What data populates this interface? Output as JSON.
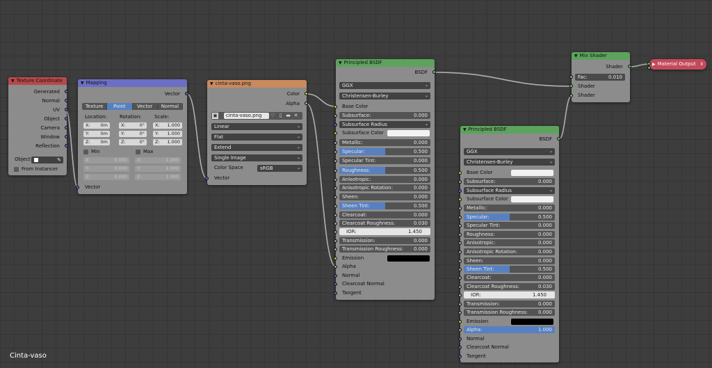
{
  "texture_coordinate": {
    "title": "Texture Coordinate",
    "outputs": [
      "Generated",
      "Normal",
      "UV",
      "Object",
      "Camera",
      "Window",
      "Reflection"
    ],
    "object_label": "Object",
    "from_instancer": "From Instancer"
  },
  "mapping": {
    "title": "Mapping",
    "output": "Vector",
    "tabs": [
      "Texture",
      "Point",
      "Vector",
      "Normal"
    ],
    "active_tab": "Point",
    "location_label": "Location:",
    "rotation_label": "Rotation:",
    "scale_label": "Scale:",
    "location": [
      {
        "axis": "X:",
        "value": "0m"
      },
      {
        "axis": "Y:",
        "value": "0m"
      },
      {
        "axis": "Z:",
        "value": "0m"
      }
    ],
    "rotation": [
      {
        "axis": "X:",
        "value": "0°"
      },
      {
        "axis": "Y:",
        "value": "0°"
      },
      {
        "axis": "Z:",
        "value": "0°"
      }
    ],
    "scale": [
      {
        "axis": "X:",
        "value": "1.000"
      },
      {
        "axis": "Y:",
        "value": "1.000"
      },
      {
        "axis": "Z:",
        "value": "1.000"
      }
    ],
    "min_label": "Min",
    "max_label": "Max",
    "min": [
      {
        "axis": "X:",
        "value": "0.000"
      },
      {
        "axis": "Y:",
        "value": "0.000"
      },
      {
        "axis": "Z:",
        "value": "0.000"
      }
    ],
    "max": [
      {
        "axis": "X:",
        "value": "1.000"
      },
      {
        "axis": "Y:",
        "value": "1.000"
      },
      {
        "axis": "Z:",
        "value": "1.000"
      }
    ],
    "input": "Vector"
  },
  "image_texture": {
    "title": "cinta-vaso.png",
    "outputs": [
      "Color",
      "Alpha"
    ],
    "image_name": "cinta-vaso.png",
    "interpolation": "Linear",
    "projection": "Flat",
    "extension": "Extend",
    "source": "Single Image",
    "color_space_label": "Color Space",
    "color_space": "sRGB",
    "input": "Vector"
  },
  "bsdf1": {
    "title": "Principled BSDF",
    "output": "BSDF",
    "distribution": "GGX",
    "subsurface_method": "Christensen-Burley",
    "base_color": "Base Color",
    "subsurface": {
      "label": "Subsurface:",
      "value": "0.000"
    },
    "subsurface_radius": "Subsurface Radius",
    "subsurface_color": "Subsurface Color",
    "params": [
      {
        "label": "Metallic:",
        "value": "0.000",
        "fill": 0
      },
      {
        "label": "Specular:",
        "value": "0.500",
        "fill": 0.5
      },
      {
        "label": "Specular Tint:",
        "value": "0.000",
        "fill": 0
      },
      {
        "label": "Roughness:",
        "value": "0.500",
        "fill": 0.5
      },
      {
        "label": "Anisotropic:",
        "value": "0.000",
        "fill": 0
      },
      {
        "label": "Anisotropic Rotation:",
        "value": "0.000",
        "fill": 0
      },
      {
        "label": "Sheen:",
        "value": "0.000",
        "fill": 0
      },
      {
        "label": "Sheen Tint:",
        "value": "0.500",
        "fill": 0.5
      },
      {
        "label": "Clearcoat:",
        "value": "0.000",
        "fill": 0
      },
      {
        "label": "Clearcoat Roughness:",
        "value": "0.030",
        "fill": 0
      }
    ],
    "ior": {
      "label": "IOR:",
      "value": "1.450"
    },
    "params2": [
      {
        "label": "Transmission:",
        "value": "0.000",
        "fill": 0
      },
      {
        "label": "Transmission Roughness:",
        "value": "0.000",
        "fill": 0
      }
    ],
    "emission": "Emission",
    "tail": [
      "Alpha",
      "Normal",
      "Clearcoat Normal",
      "Tangent"
    ]
  },
  "bsdf2": {
    "title": "Principled BSDF",
    "output": "BSDF",
    "distribution": "GGX",
    "subsurface_method": "Christensen-Burley",
    "base_color": "Base Color",
    "subsurface": {
      "label": "Subsurface:",
      "value": "0.000"
    },
    "subsurface_radius": "Subsurface Radius",
    "subsurface_color": "Subsurface Color",
    "params": [
      {
        "label": "Metallic:",
        "value": "0.000",
        "fill": 0
      },
      {
        "label": "Specular:",
        "value": "0.500",
        "fill": 0.5
      },
      {
        "label": "Specular Tint:",
        "value": "0.000",
        "fill": 0
      },
      {
        "label": "Roughness:",
        "value": "0.000",
        "fill": 0
      },
      {
        "label": "Anisotropic:",
        "value": "0.000",
        "fill": 0
      },
      {
        "label": "Anisotropic Rotation:",
        "value": "0.000",
        "fill": 0
      },
      {
        "label": "Sheen:",
        "value": "0.000",
        "fill": 0
      },
      {
        "label": "Sheen Tint:",
        "value": "0.500",
        "fill": 0.5
      },
      {
        "label": "Clearcoat:",
        "value": "0.000",
        "fill": 0
      },
      {
        "label": "Clearcoat Roughness:",
        "value": "0.030",
        "fill": 0
      }
    ],
    "ior": {
      "label": "IOR:",
      "value": "1.450"
    },
    "params2": [
      {
        "label": "Transmission:",
        "value": "0.000",
        "fill": 0
      },
      {
        "label": "Transmission Roughness:",
        "value": "0.000",
        "fill": 0
      }
    ],
    "emission": "Emission",
    "alpha": {
      "label": "Alpha:",
      "value": "1.000",
      "fill": 1
    },
    "tail": [
      "Normal",
      "Clearcoat Normal",
      "Tangent"
    ]
  },
  "mix_shader": {
    "title": "Mix Shader",
    "output": "Shader",
    "fac": {
      "label": "Fac:",
      "value": "0.010"
    },
    "inputs": [
      "Shader",
      "Shader"
    ]
  },
  "material_output": {
    "title": "Material Output"
  },
  "material_name": "Cinta-vaso",
  "colors": {
    "texture_header": "#b8484a",
    "mapping_header": "#6b6fc4",
    "image_header": "#c98a5e",
    "shader_header": "#5ca35c",
    "output_header": "#c44a5a",
    "wire": "#b0b0b0",
    "active_blue": "#5680c2"
  }
}
